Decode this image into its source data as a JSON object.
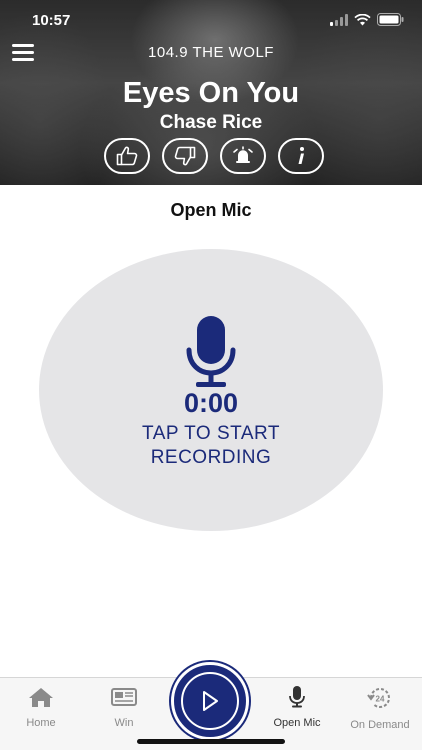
{
  "status_bar": {
    "time": "10:57",
    "icons": [
      "signal-icon",
      "wifi-icon",
      "battery-icon"
    ]
  },
  "header": {
    "station": "104.9 THE WOLF",
    "song_title": "Eyes On You",
    "artist": "Chase Rice",
    "actions": [
      "thumbs-up-icon",
      "thumbs-down-icon",
      "alarm-icon",
      "info-icon"
    ]
  },
  "main": {
    "section_title": "Open Mic",
    "timer": "0:00",
    "prompt_line1": "TAP TO START",
    "prompt_line2": "RECORDING"
  },
  "tabbar": {
    "tabs": [
      {
        "label": "Home",
        "icon": "home-icon"
      },
      {
        "label": "Win",
        "icon": "ticket-icon"
      },
      {
        "label": "Open Mic",
        "icon": "microphone-icon",
        "active": true
      },
      {
        "label": "On Demand",
        "icon": "on-demand-24-icon"
      }
    ],
    "badge_24": "24"
  },
  "colors": {
    "accent": "#1b2a7a",
    "circle_bg": "#e5e5e7",
    "tab_inactive": "#8a8a8a"
  }
}
